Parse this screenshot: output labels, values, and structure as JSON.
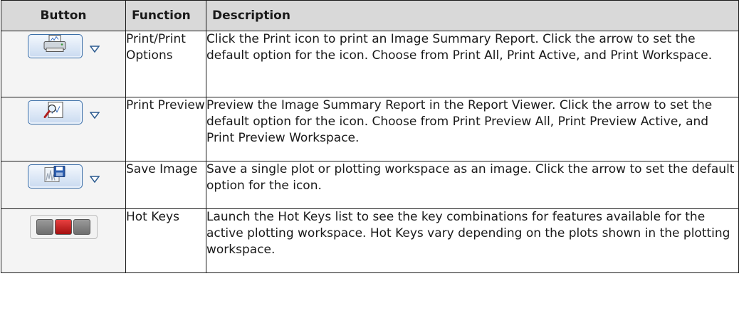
{
  "table": {
    "headers": {
      "button": "Button",
      "function": "Function",
      "description": "Description"
    },
    "rows": [
      {
        "icon": "print-icon",
        "function": "Print/Print Options",
        "description": "Click the Print icon to print an Image Summary Report. Click the arrow to set the default option for the icon. Choose from Print All, Print Active, and Print Workspace."
      },
      {
        "icon": "print-preview-icon",
        "function": "Print Preview",
        "description": "Preview the Image Summary Report in the Report Viewer. Click the arrow to set the default option for the icon. Choose from Print Preview All, Print Preview Active, and Print Preview Workspace."
      },
      {
        "icon": "save-image-icon",
        "function": "Save Image",
        "description": "Save a single plot or plotting workspace as an image. Click the arrow to set the default option for the icon."
      },
      {
        "icon": "hot-keys-icon",
        "function": "Hot Keys",
        "description": "Launch the Hot Keys list to see the key combinations for features available for the active plotting workspace. Hot Keys vary depending on the plots shown in the plotting workspace."
      }
    ]
  },
  "colors": {
    "header_bg": "#d9d9d9",
    "button_border": "#3c6fa8",
    "hot_key_red": "#d22020"
  }
}
